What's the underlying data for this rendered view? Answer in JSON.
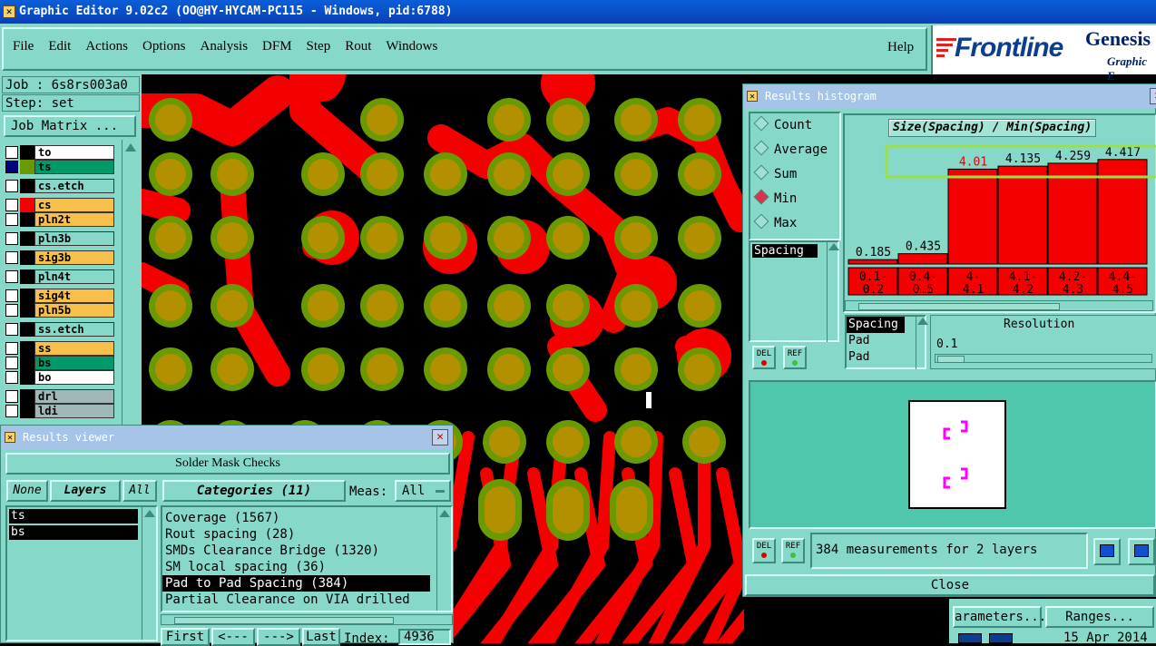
{
  "window": {
    "title": "Graphic Editor 9.02c2 (OO@HY-HYCAM-PC115 - Windows, pid:6788)"
  },
  "menu": [
    "File",
    "Edit",
    "Actions",
    "Options",
    "Analysis",
    "DFM",
    "Step",
    "Rout",
    "Windows"
  ],
  "help_label": "Help",
  "brand": {
    "logo": "Frontline",
    "product": "Genesis",
    "subtitle": "Graphic E"
  },
  "job": {
    "job_label": "Job : 6s8rs003a0",
    "step_label": "Step: set",
    "matrix_button": "Job Matrix ..."
  },
  "layers": [
    {
      "name": "to",
      "color": "#ffffff",
      "swatch": "#000000"
    },
    {
      "name": "ts",
      "color": "#009a6a",
      "swatch": "#6a9a00"
    },
    {
      "name": "cs.etch",
      "color": "#86d8c8",
      "swatch": "#000000"
    },
    {
      "name": "cs",
      "color": "#f6c04a",
      "swatch": "#f40000"
    },
    {
      "name": "pln2t",
      "color": "#f6c04a",
      "swatch": "#000000"
    },
    {
      "name": "pln3b",
      "color": "#86d8c8",
      "swatch": "#000000"
    },
    {
      "name": "sig3b",
      "color": "#f6c04a",
      "swatch": "#000000"
    },
    {
      "name": "pln4t",
      "color": "#86d8c8",
      "swatch": "#000000"
    },
    {
      "name": "sig4t",
      "color": "#f6c04a",
      "swatch": "#000000"
    },
    {
      "name": "pln5b",
      "color": "#f6c04a",
      "swatch": "#000000"
    },
    {
      "name": "ss.etch",
      "color": "#86d8c8",
      "swatch": "#000000"
    },
    {
      "name": "ss",
      "color": "#f6c04a",
      "swatch": "#000000"
    },
    {
      "name": "bs",
      "color": "#009a6a",
      "swatch": "#000000"
    },
    {
      "name": "bo",
      "color": "#ffffff",
      "swatch": "#000000"
    },
    {
      "name": "drl",
      "color": "#a0b8b8",
      "swatch": "#000000"
    },
    {
      "name": "ldi",
      "color": "#a0b8b8",
      "swatch": "#000000"
    }
  ],
  "results_viewer": {
    "title": "Results viewer",
    "heading": "Solder Mask Checks",
    "none_btn": "None",
    "layers_btn": "Layers",
    "all_btn": "All",
    "categories_btn": "Categories (11)",
    "meas_label": "Meas:",
    "meas_value": "All",
    "layer_list": [
      "ts",
      "bs"
    ],
    "categories": [
      "Coverage (1567)",
      "Rout spacing (28)",
      "SMDs Clearance Bridge (1320)",
      "SM local spacing (36)",
      "Pad to Pad Spacing (384)",
      "Partial Clearance on VIA drilled"
    ],
    "selected_category": 4,
    "nav": {
      "first": "First",
      "prev": "<---",
      "next": "--->",
      "last": "Last",
      "index_label": "Index:",
      "index_value": "4936"
    }
  },
  "histogram": {
    "title": "Results histogram",
    "modes": [
      "Count",
      "Average",
      "Sum",
      "Min",
      "Max"
    ],
    "selected_mode": "Min",
    "spacing_label": "Spacing",
    "chart_title": "Size(Spacing) / Min(Spacing)",
    "del_label": "DEL",
    "ref_label": "REF",
    "list": [
      "Spacing",
      "Pad",
      "Pad"
    ],
    "resolution_label": "Resolution",
    "resolution_value": "0.1",
    "status": "384 measurements for 2 layers",
    "close_label": "Close"
  },
  "chart_data": {
    "type": "bar",
    "title": "Size(Spacing) / Min(Spacing)",
    "categories": [
      "0.1-0.2",
      "0.4-0.5",
      "4-4.1",
      "4.1-4.2",
      "4.2-4.3",
      "4.4-4.5"
    ],
    "values": [
      0.185,
      0.435,
      4.01,
      4.135,
      4.259,
      4.417
    ],
    "data_labels": [
      "0.185",
      "0.435",
      "4.01",
      "4.135",
      "4.259",
      "4.417"
    ],
    "category_lines": [
      [
        "0.1-",
        "0.2"
      ],
      [
        "0.4-",
        "0.5"
      ],
      [
        "4-",
        "4.1"
      ],
      [
        "4.1-",
        "4.2"
      ],
      [
        "4.2-",
        "4.3"
      ],
      [
        "4.4-",
        "4.5"
      ]
    ],
    "ylim": [
      0,
      4.6
    ],
    "colors": {
      "bar": "#f40000",
      "highlight": "#e00000"
    }
  },
  "bottom_right": {
    "params_btn": "arameters...",
    "ranges_btn": "Ranges...",
    "date": "15 Apr 2014"
  },
  "colors": {
    "trace": "#f40000",
    "pad": "#b29000",
    "pad_ring": "#6a9a00",
    "panel": "#86d8c8",
    "highlight": "#9ae04a"
  }
}
